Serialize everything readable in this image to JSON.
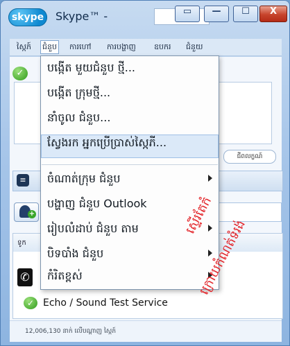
{
  "window": {
    "logo_text": "skype",
    "title": "Skype™ -"
  },
  "window_buttons": {
    "restore": "▭",
    "minimize": "—",
    "maximize": "☐",
    "close": "X"
  },
  "menubar": [
    {
      "label": "ស្កៃភ៍"
    },
    {
      "label": "ជំនួប"
    },
    {
      "label": "ការហៅ"
    },
    {
      "label": "ការបង្ហាញ"
    },
    {
      "label": "ឧបករ"
    },
    {
      "label": "ជំនួយ"
    }
  ],
  "dropdown": {
    "items": [
      {
        "label": "បង្កើត មួយជំនួប ថ្មី...",
        "submenu": false
      },
      {
        "label": "បង្កើត ក្រុមថ្មី...",
        "submenu": false
      },
      {
        "label": "នាំចូល ជំនួប...",
        "submenu": false
      },
      {
        "label": "ស្វែងរក អ្នកប្រើប្រាស់ស្កៃភី...",
        "submenu": false,
        "highlighted": true
      },
      {
        "label": "ចំណាត់ក្រុម ជំនួប",
        "submenu": true
      },
      {
        "label": "បង្ហាញ ជំនួប Outlook",
        "submenu": false
      },
      {
        "label": "រៀបលំដាប់ ជំនួប តាម",
        "submenu": true
      },
      {
        "label": "បិទបាំង ជំនួប",
        "submenu": true
      },
      {
        "label": "កំរិតខ្ពស់",
        "submenu": true
      }
    ]
  },
  "panels": {
    "status_dropdown": "ជីពលក្ខណ៍",
    "contacts_header": "ទូក",
    "echo_contact": "Echo / Sound Test Service"
  },
  "footer": {
    "online_count": "12,006,130 នាក់ លើបណ្ដាញ ស្កៃភ៍"
  },
  "annotation": {
    "line1": "ស្ទើរតែកំ",
    "line2": "ក្រោយកំណត់ទំរង់"
  },
  "colors": {
    "accent": "#0f89d1",
    "annotation": "#e3262b",
    "highlight": "#dbe9f8"
  }
}
